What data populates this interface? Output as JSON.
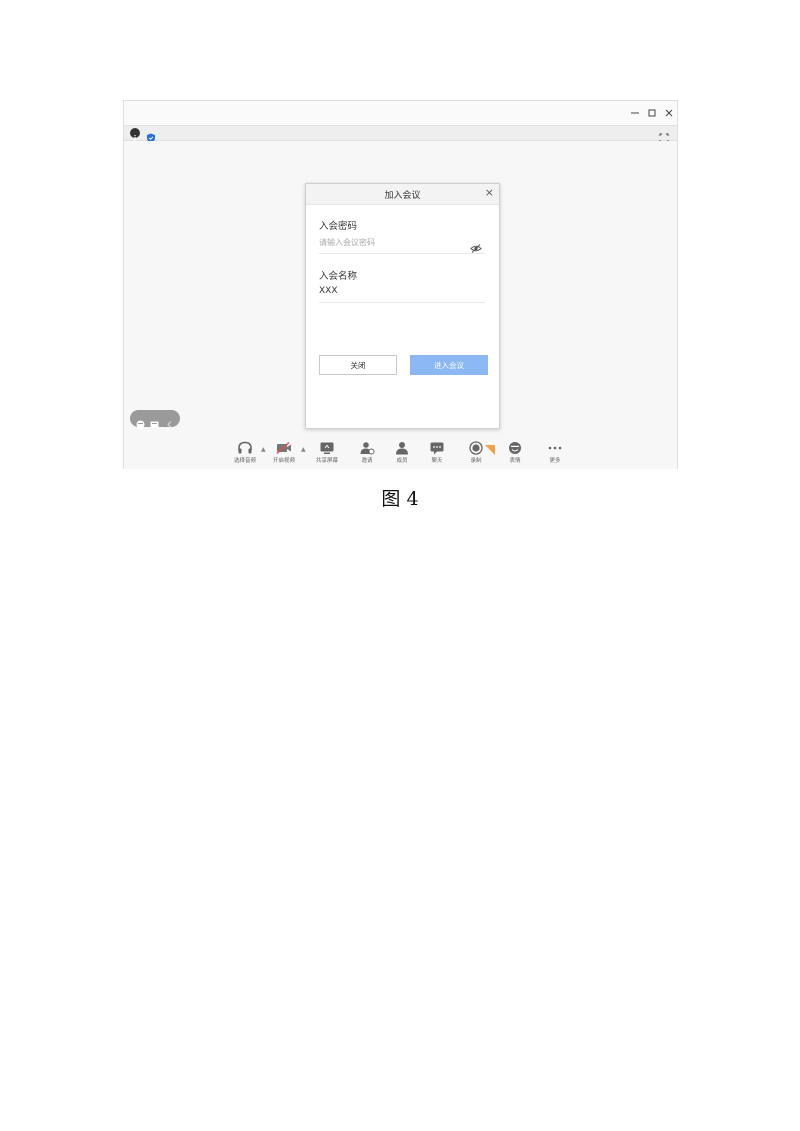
{
  "window": {
    "controls": {
      "minimize_icon": "minimize-icon",
      "maximize_icon": "maximize-icon",
      "close_icon": "close-icon"
    },
    "toolbar": {
      "info_icon": "info-icon",
      "shield_icon": "shield-icon",
      "fullscreen_icon": "fullscreen-icon"
    }
  },
  "dialog": {
    "title": "加入会议",
    "close_glyph": "×",
    "password": {
      "label": "入会密码",
      "placeholder": "请输入会议密码"
    },
    "name": {
      "label": "入会名称",
      "value": "XXX"
    },
    "close_button": "关闭",
    "join_button": "进入会议"
  },
  "bottom_bar": {
    "items": [
      {
        "label": "选择音频",
        "icon": "headset-icon"
      },
      {
        "label": "开启视频",
        "icon": "video-off-icon"
      },
      {
        "label": "共享屏幕",
        "icon": "share-screen-icon"
      },
      {
        "label": "邀请",
        "icon": "invite-icon"
      },
      {
        "label": "成员",
        "icon": "members-icon"
      },
      {
        "label": "聊天",
        "icon": "chat-icon"
      },
      {
        "label": "录制",
        "icon": "record-icon"
      },
      {
        "label": "表情",
        "icon": "emoji-icon"
      },
      {
        "label": "更多",
        "icon": "more-icon"
      }
    ]
  },
  "caption": "图 4",
  "colors": {
    "accent": "#8bb8f2",
    "shield": "#2b6fd6",
    "record_badge": "#f0a24a"
  }
}
